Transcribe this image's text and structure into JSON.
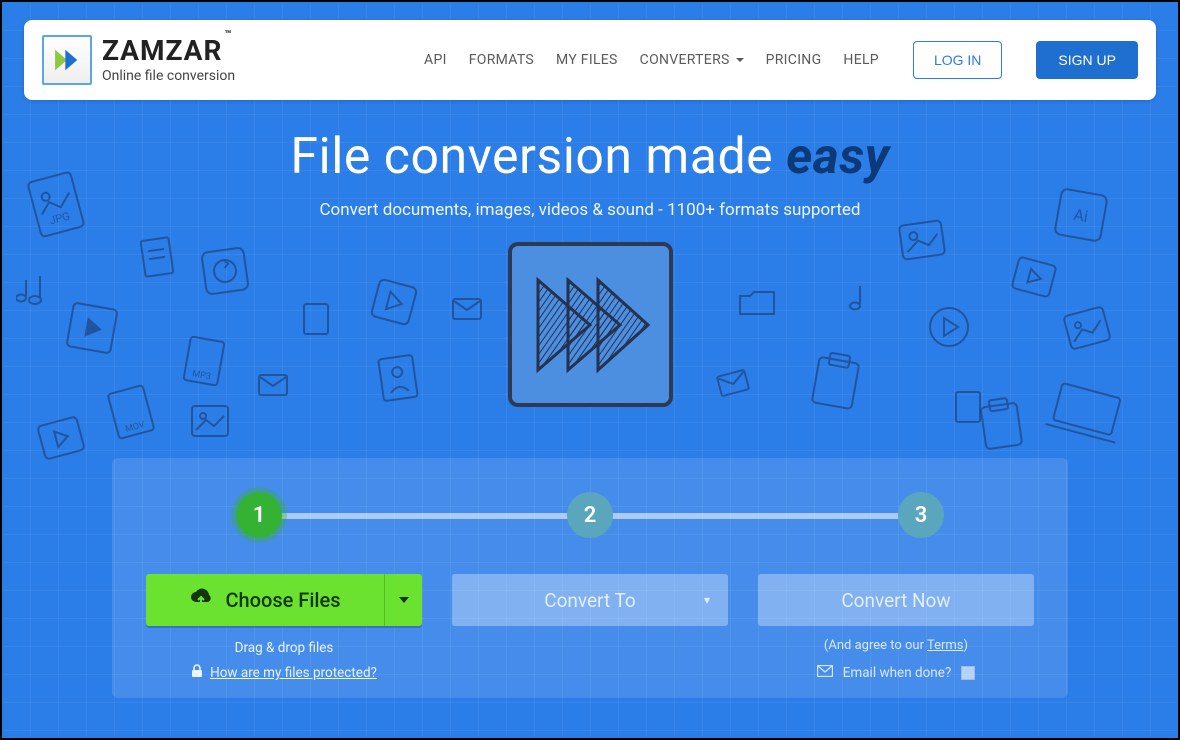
{
  "brand": {
    "name": "ZAMZAR",
    "tm": "™",
    "tagline": "Online file conversion"
  },
  "nav": {
    "api": "API",
    "formats": "FORMATS",
    "myfiles": "MY FILES",
    "converters": "CONVERTERS",
    "pricing": "PRICING",
    "help": "HELP",
    "login": "LOG IN",
    "signup": "SIGN UP"
  },
  "hero": {
    "title_prefix": "File conversion made ",
    "title_em": "easy",
    "subtitle": "Convert documents, images, videos & sound - 1100+ formats supported"
  },
  "steps": {
    "s1": "1",
    "s2": "2",
    "s3": "3",
    "active": 1
  },
  "controls": {
    "choose_label": "Choose Files",
    "drag_hint": "Drag & drop files",
    "protect_link": "How are my files protected?",
    "convert_to": "Convert To",
    "convert_now": "Convert Now",
    "terms_prefix": "(And agree to our ",
    "terms_link": "Terms",
    "terms_suffix": ")",
    "email_label": "Email when done?",
    "email_checked": false
  }
}
